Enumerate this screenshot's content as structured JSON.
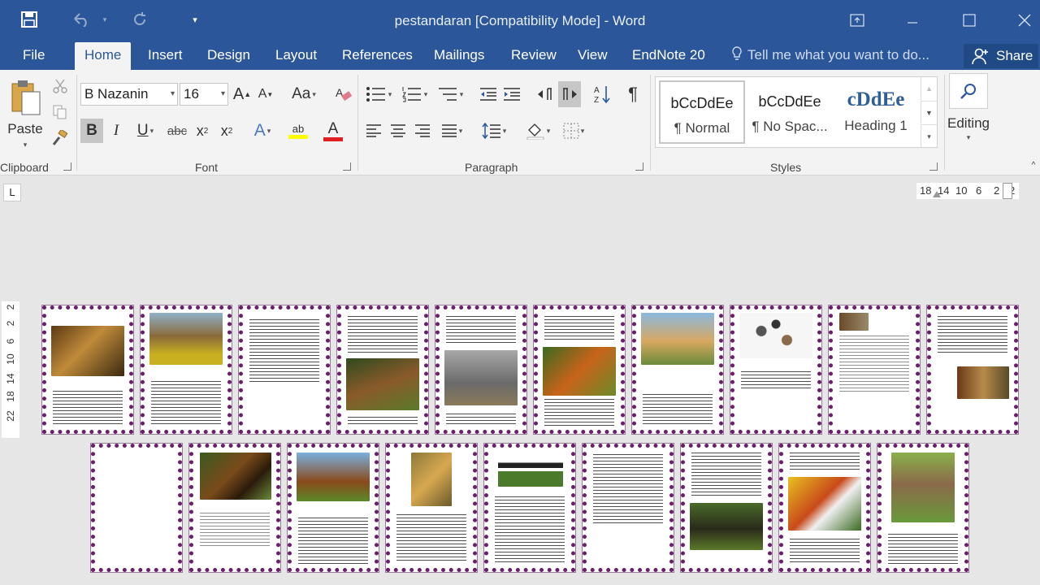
{
  "window": {
    "title": "pestandaran [Compatibility Mode] - Word"
  },
  "qat": {
    "customize_glyph": "▾"
  },
  "tabs": [
    "File",
    "Home",
    "Insert",
    "Design",
    "Layout",
    "References",
    "Mailings",
    "Review",
    "View",
    "EndNote 20"
  ],
  "active_tab": "Home",
  "tellme": {
    "placeholder": "Tell me what you want to do..."
  },
  "share": {
    "label": "Share"
  },
  "clipboard": {
    "paste_label": "Paste",
    "group_label": "Clipboard"
  },
  "font": {
    "name": "B Nazanin",
    "size": "16",
    "group_label": "Font",
    "grow": "A",
    "shrink": "A",
    "case": "Aa",
    "bold": "B",
    "italic": "I",
    "underline": "U",
    "strike": "abc",
    "subscript": "x",
    "superscript": "x",
    "text_effects": "A",
    "highlight": "ab",
    "font_color": "A"
  },
  "paragraph": {
    "group_label": "Paragraph",
    "pilcrow": "¶"
  },
  "styles": {
    "group_label": "Styles",
    "items": [
      {
        "sample": "bCcDdEe",
        "name": "¶ Normal"
      },
      {
        "sample": "bCcDdEe",
        "name": "¶ No Spac..."
      },
      {
        "sample": "cDdEe",
        "name": "Heading 1"
      }
    ]
  },
  "editing": {
    "label": "Editing"
  },
  "ruler": {
    "tab_selector": "L",
    "horizontal_ticks": [
      "18",
      "14",
      "10",
      "6",
      "2",
      "2"
    ],
    "vertical_ticks": [
      "2",
      "2",
      "6",
      "10",
      "14",
      "18",
      "22"
    ]
  },
  "colors": {
    "accent": "#2b579a",
    "page_border": "#6a1f6a"
  }
}
